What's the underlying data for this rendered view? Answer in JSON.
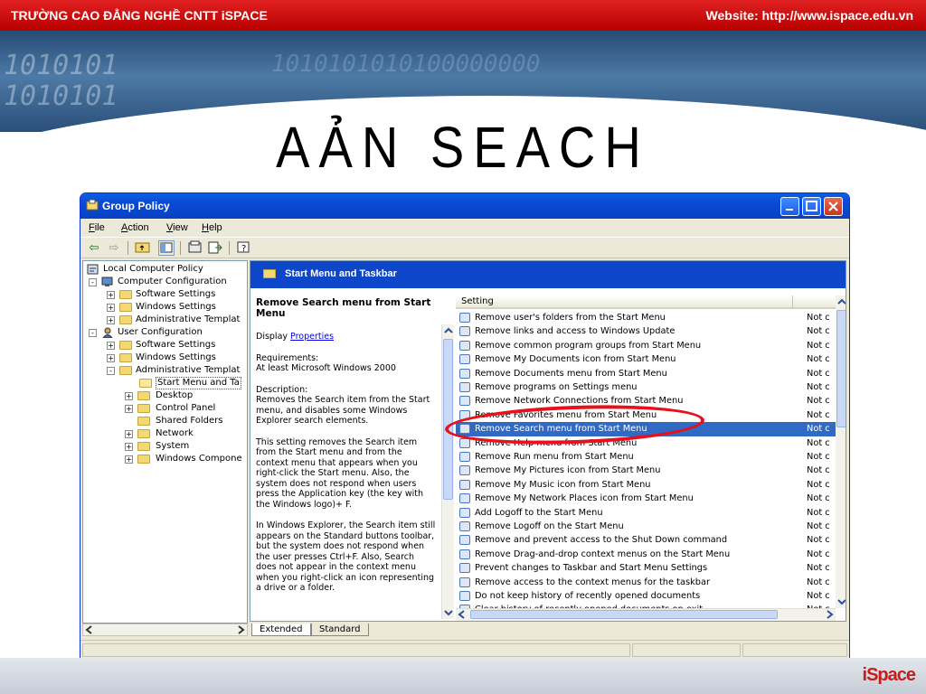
{
  "slide": {
    "school": "TRƯỜNG CAO ĐẲNG NGHỀ CNTT iSPACE",
    "website": "Website: http://www.ispace.edu.vn",
    "banner_bits_1": "1010101\n1010101",
    "banner_bits_2": "1010101010100000000",
    "title": "AẢN SEACH",
    "logo": "iSpace"
  },
  "window": {
    "title": "Group Policy",
    "menu": [
      "File",
      "Action",
      "View",
      "Help"
    ],
    "toolbar_icons": [
      "back-arrow-icon",
      "forward-arrow-icon",
      "up-folder-icon",
      "show-hide-tree-icon",
      "properties-icon",
      "export-list-icon",
      "help-icon"
    ]
  },
  "tree": [
    {
      "label": "Local Computer Policy",
      "level": 0
    },
    {
      "label": "Computer Configuration",
      "level": 1,
      "expander": "-"
    },
    {
      "label": "Software Settings",
      "level": 2,
      "expander": "+"
    },
    {
      "label": "Windows Settings",
      "level": 2,
      "expander": "+"
    },
    {
      "label": "Administrative Templat",
      "level": 2,
      "expander": "+"
    },
    {
      "label": "User Configuration",
      "level": 1,
      "expander": "-"
    },
    {
      "label": "Software Settings",
      "level": 2,
      "expander": "+"
    },
    {
      "label": "Windows Settings",
      "level": 2,
      "expander": "+"
    },
    {
      "label": "Administrative Templat",
      "level": 2,
      "expander": "-"
    },
    {
      "label": "Start Menu and Ta",
      "level": 3,
      "selected": true
    },
    {
      "label": "Desktop",
      "level": 3,
      "expander": "+"
    },
    {
      "label": "Control Panel",
      "level": 3,
      "expander": "+"
    },
    {
      "label": "Shared Folders",
      "level": 3
    },
    {
      "label": "Network",
      "level": 3,
      "expander": "+"
    },
    {
      "label": "System",
      "level": 3,
      "expander": "+"
    },
    {
      "label": "Windows Compone",
      "level": 3,
      "expander": "+"
    }
  ],
  "panel": {
    "header": "Start Menu and Taskbar",
    "desc_title": "Remove Search menu from Start Menu",
    "display_prefix": "Display ",
    "display_link": "Properties",
    "requirements": "Requirements:\nAt least Microsoft Windows 2000",
    "description": "Description:\nRemoves the Search item from the Start menu, and disables some Windows Explorer search elements.",
    "para1": "This setting removes the Search item from the Start menu and from the context menu that appears when you right-click the Start menu. Also, the system does not respond when users press the Application key (the key with the Windows logo)+ F.",
    "para2": "In Windows Explorer, the Search item still appears on the Standard buttons toolbar, but the system does not respond when the user presses Ctrl+F. Also, Search does not appear in the context menu when you right-click an icon representing a drive or a folder."
  },
  "list": {
    "column": "Setting",
    "state_text": "Not c",
    "items": [
      "Remove user's folders from the Start Menu",
      "Remove links and access to Windows Update",
      "Remove common program groups from Start Menu",
      "Remove My Documents icon from Start Menu",
      "Remove Documents menu from Start Menu",
      "Remove programs on Settings menu",
      "Remove Network Connections from Start Menu",
      "Remove Favorites menu from Start Menu",
      "Remove Search menu from Start Menu",
      "Remove Help menu from Start Menu",
      "Remove Run menu from Start Menu",
      "Remove My Pictures icon from Start Menu",
      "Remove My Music icon from Start Menu",
      "Remove My Network Places icon from Start Menu",
      "Add Logoff to the Start Menu",
      "Remove Logoff on the Start Menu",
      "Remove and prevent access to the Shut Down command",
      "Remove Drag-and-drop context menus on the Start Menu",
      "Prevent changes to Taskbar and Start Menu Settings",
      "Remove access to the context menus for the taskbar",
      "Do not keep history of recently opened documents",
      "Clear history of recently opened documents on exit"
    ],
    "selected_index": 8
  },
  "tabs": [
    "Extended",
    "Standard"
  ],
  "colors": {
    "selection": "#316ac5",
    "title_bar": "#0a49d6",
    "highlight_ring": "#e8101a"
  }
}
